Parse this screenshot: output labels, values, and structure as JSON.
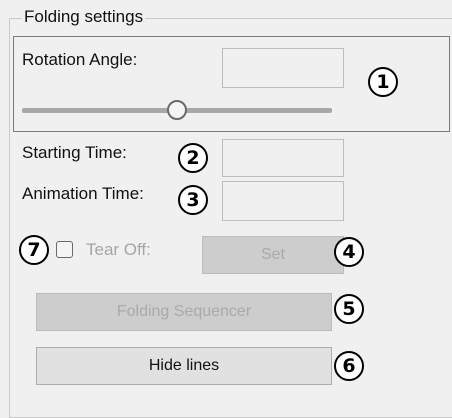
{
  "group": {
    "title": "Folding settings"
  },
  "rotation": {
    "label": "Rotation Angle:",
    "value": "",
    "slider_fraction": 0.5
  },
  "starting_time": {
    "label": "Starting Time:",
    "value": ""
  },
  "animation_time": {
    "label": "Animation Time:",
    "value": ""
  },
  "tear_off": {
    "label": "Tear Off:",
    "checked": false,
    "enabled": false
  },
  "buttons": {
    "set_label": "Set",
    "folding_sequencer_label": "Folding Sequencer",
    "hide_lines_label": "Hide lines"
  },
  "callouts": [
    "1",
    "2",
    "3",
    "4",
    "5",
    "6",
    "7"
  ]
}
